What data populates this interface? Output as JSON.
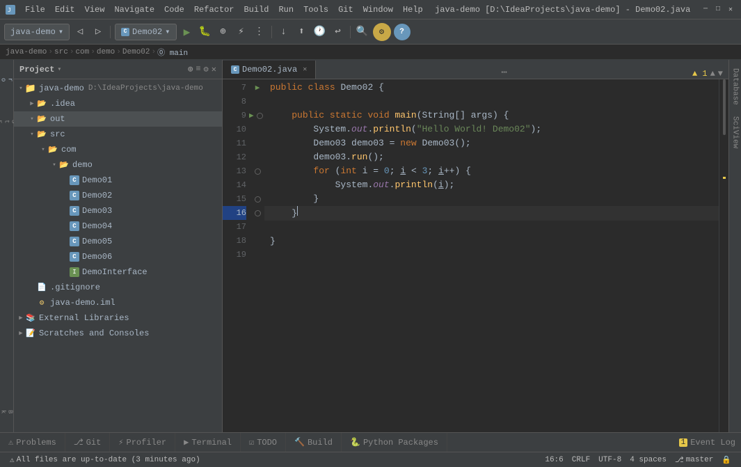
{
  "titleBar": {
    "title": "java-demo [D:\\IdeaProjects\\java-demo] - Demo02.java",
    "menus": [
      "java-demo",
      "File",
      "Edit",
      "View",
      "Navigate",
      "Code",
      "Refactor",
      "Build",
      "Run",
      "Tools",
      "Git",
      "Window",
      "Help"
    ]
  },
  "breadcrumb": {
    "items": [
      "java-demo",
      "src",
      "com",
      "demo",
      "Demo02",
      "main"
    ]
  },
  "projectPanel": {
    "title": "Project",
    "tree": [
      {
        "id": "java-demo",
        "label": "java-demo",
        "path": "D:\\IdeaProjects\\java-demo",
        "indent": 0,
        "type": "root",
        "expanded": true
      },
      {
        "id": "idea",
        "label": ".idea",
        "indent": 1,
        "type": "folder",
        "expanded": false
      },
      {
        "id": "out",
        "label": "out",
        "indent": 1,
        "type": "folder-open",
        "expanded": true,
        "selected": true
      },
      {
        "id": "src",
        "label": "src",
        "indent": 1,
        "type": "folder-open",
        "expanded": true
      },
      {
        "id": "com",
        "label": "com",
        "indent": 2,
        "type": "folder-open",
        "expanded": true
      },
      {
        "id": "demo",
        "label": "demo",
        "indent": 3,
        "type": "folder-open",
        "expanded": true
      },
      {
        "id": "Demo01",
        "label": "Demo01",
        "indent": 4,
        "type": "java"
      },
      {
        "id": "Demo02",
        "label": "Demo02",
        "indent": 4,
        "type": "java"
      },
      {
        "id": "Demo03",
        "label": "Demo03",
        "indent": 4,
        "type": "java"
      },
      {
        "id": "Demo04",
        "label": "Demo04",
        "indent": 4,
        "type": "java"
      },
      {
        "id": "Demo05",
        "label": "Demo05",
        "indent": 4,
        "type": "java"
      },
      {
        "id": "Demo06",
        "label": "Demo06",
        "indent": 4,
        "type": "java"
      },
      {
        "id": "DemoInterface",
        "label": "DemoInterface",
        "indent": 4,
        "type": "java-interface"
      },
      {
        "id": "gitignore",
        "label": ".gitignore",
        "indent": 1,
        "type": "file"
      },
      {
        "id": "iml",
        "label": "java-demo.iml",
        "indent": 1,
        "type": "iml"
      },
      {
        "id": "external",
        "label": "External Libraries",
        "indent": 0,
        "type": "folder",
        "expanded": false
      },
      {
        "id": "scratches",
        "label": "Scratches and Consoles",
        "indent": 0,
        "type": "folder",
        "expanded": false
      }
    ]
  },
  "editor": {
    "tab": "Demo02.java",
    "lines": [
      {
        "num": 7,
        "content": "public class Demo02 {",
        "gutter": "arrow"
      },
      {
        "num": 8,
        "content": "",
        "gutter": ""
      },
      {
        "num": 9,
        "content": "    public static void main(String[] args) {",
        "gutter": "arrow-bp"
      },
      {
        "num": 10,
        "content": "        System.out.println(\"Hello World! Demo02\");",
        "gutter": ""
      },
      {
        "num": 11,
        "content": "        Demo03 demo03 = new Demo03();",
        "gutter": ""
      },
      {
        "num": 12,
        "content": "        demo03.run();",
        "gutter": ""
      },
      {
        "num": 13,
        "content": "        for (int i = 0; i < 3; i++) {",
        "gutter": "bp-outline"
      },
      {
        "num": 14,
        "content": "            System.out.println(i);",
        "gutter": ""
      },
      {
        "num": 15,
        "content": "        }",
        "gutter": "bp-outline"
      },
      {
        "num": 16,
        "content": "    }",
        "gutter": "bp-outline"
      },
      {
        "num": 17,
        "content": "",
        "gutter": ""
      },
      {
        "num": 18,
        "content": "}",
        "gutter": ""
      },
      {
        "num": 19,
        "content": "",
        "gutter": ""
      }
    ]
  },
  "statusBar": {
    "warnings": "▲ 1",
    "position": "16:6",
    "lineEnding": "CRLF",
    "encoding": "UTF-8",
    "indent": "4 spaces",
    "git": "master",
    "lock": "🔒"
  },
  "bottomTabs": [
    {
      "label": "Problems",
      "icon": "⚠"
    },
    {
      "label": "Git",
      "icon": ""
    },
    {
      "label": "Profiler",
      "icon": ""
    },
    {
      "label": "Terminal",
      "icon": ""
    },
    {
      "label": "TODO",
      "icon": ""
    },
    {
      "label": "Build",
      "icon": ""
    },
    {
      "label": "Python Packages",
      "icon": ""
    }
  ],
  "eventLog": "1  Event Log",
  "rightSidebar": [
    "Database",
    "SciView"
  ],
  "statusBottom": "All files are up-to-date (3 minutes ago)"
}
